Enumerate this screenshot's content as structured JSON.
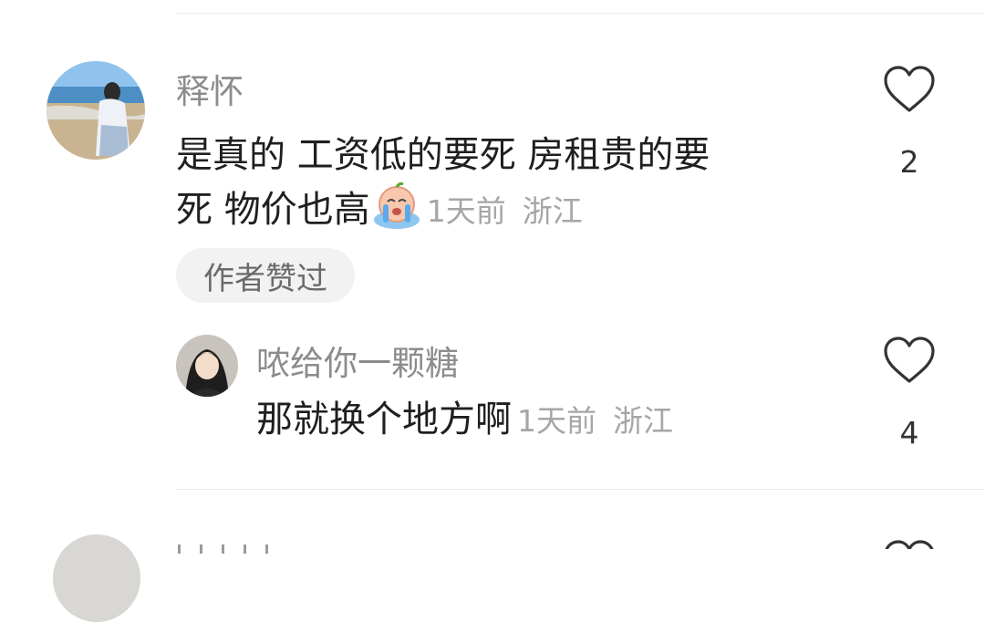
{
  "comment": {
    "user": "释怀",
    "text_line1": "是真的 工资低的要死 房租贵的要",
    "text_line2": "死 物价也高",
    "emoji": "crying-face-emoji",
    "time": "1天前",
    "location": "浙江",
    "badge": "作者赞过",
    "likes": "2"
  },
  "reply": {
    "user": "哝给你一颗糖",
    "text": "那就换个地方啊",
    "time": "1天前",
    "location": "浙江",
    "likes": "4"
  },
  "colors": {
    "username": "#8c8c8c",
    "body_text": "#1f1f1f",
    "meta": "#a6a6a6",
    "badge_bg": "#f2f2f2",
    "divider": "#ececec"
  },
  "icons": [
    "heart-outline-icon",
    "avatar-image"
  ]
}
